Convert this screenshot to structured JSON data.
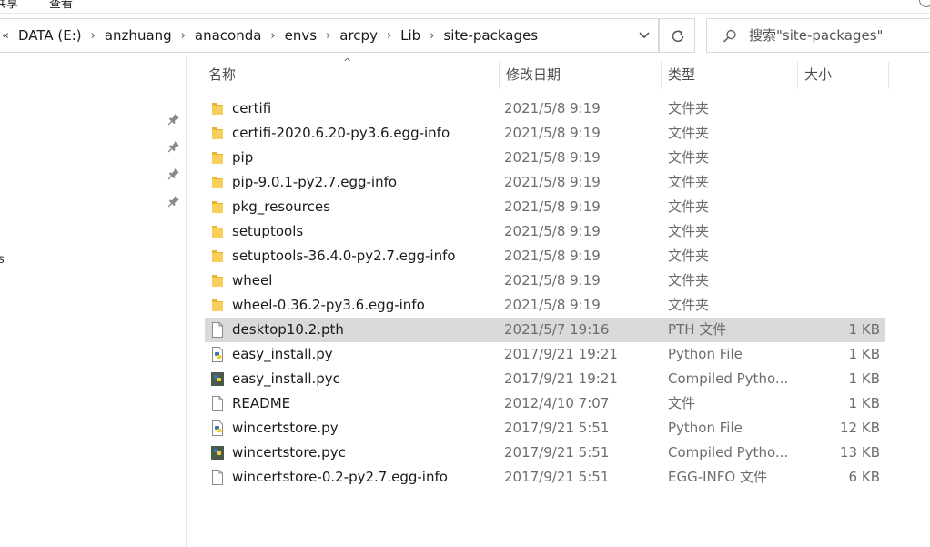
{
  "ribbon": {
    "tab_left": "共享",
    "tab_right": "查看"
  },
  "address": {
    "overflow": "«",
    "crumbs": [
      "DATA (E:)",
      "anzhuang",
      "anaconda",
      "envs",
      "arcpy",
      "Lib",
      "site-packages"
    ]
  },
  "search": {
    "placeholder": "搜索\"site-packages\""
  },
  "columns": {
    "name": "名称",
    "date": "修改日期",
    "type": "类型",
    "size": "大小"
  },
  "files": [
    {
      "name": "certifi",
      "date": "2021/5/8 9:19",
      "type": "文件夹",
      "size": "",
      "icon": "folder-icon"
    },
    {
      "name": "certifi-2020.6.20-py3.6.egg-info",
      "date": "2021/5/8 9:19",
      "type": "文件夹",
      "size": "",
      "icon": "folder-icon"
    },
    {
      "name": "pip",
      "date": "2021/5/8 9:19",
      "type": "文件夹",
      "size": "",
      "icon": "folder-icon"
    },
    {
      "name": "pip-9.0.1-py2.7.egg-info",
      "date": "2021/5/8 9:19",
      "type": "文件夹",
      "size": "",
      "icon": "folder-icon"
    },
    {
      "name": "pkg_resources",
      "date": "2021/5/8 9:19",
      "type": "文件夹",
      "size": "",
      "icon": "folder-icon"
    },
    {
      "name": "setuptools",
      "date": "2021/5/8 9:19",
      "type": "文件夹",
      "size": "",
      "icon": "folder-icon"
    },
    {
      "name": "setuptools-36.4.0-py2.7.egg-info",
      "date": "2021/5/8 9:19",
      "type": "文件夹",
      "size": "",
      "icon": "folder-icon"
    },
    {
      "name": "wheel",
      "date": "2021/5/8 9:19",
      "type": "文件夹",
      "size": "",
      "icon": "folder-icon"
    },
    {
      "name": "wheel-0.36.2-py3.6.egg-info",
      "date": "2021/5/8 9:19",
      "type": "文件夹",
      "size": "",
      "icon": "folder-icon"
    },
    {
      "name": "desktop10.2.pth",
      "date": "2021/5/7 19:16",
      "type": "PTH 文件",
      "size": "1 KB",
      "icon": "file-icon",
      "selected": true
    },
    {
      "name": "easy_install.py",
      "date": "2017/9/21 19:21",
      "type": "Python File",
      "size": "1 KB",
      "icon": "python-file-icon"
    },
    {
      "name": "easy_install.pyc",
      "date": "2017/9/21 19:21",
      "type": "Compiled Pytho...",
      "size": "1 KB",
      "icon": "python-compiled-icon"
    },
    {
      "name": "README",
      "date": "2012/4/10 7:07",
      "type": "文件",
      "size": "1 KB",
      "icon": "file-icon"
    },
    {
      "name": "wincertstore.py",
      "date": "2017/9/21 5:51",
      "type": "Python File",
      "size": "12 KB",
      "icon": "python-file-icon"
    },
    {
      "name": "wincertstore.pyc",
      "date": "2017/9/21 5:51",
      "type": "Compiled Pytho...",
      "size": "13 KB",
      "icon": "python-compiled-icon"
    },
    {
      "name": "wincertstore-0.2-py2.7.egg-info",
      "date": "2017/9/21 5:51",
      "type": "EGG-INFO 文件",
      "size": "6 KB",
      "icon": "file-icon"
    }
  ],
  "colors": {
    "selection": "#d9d9d9",
    "folder": "#f5c542",
    "python_blue": "#3b74b3",
    "python_yellow": "#f0cf3c"
  }
}
